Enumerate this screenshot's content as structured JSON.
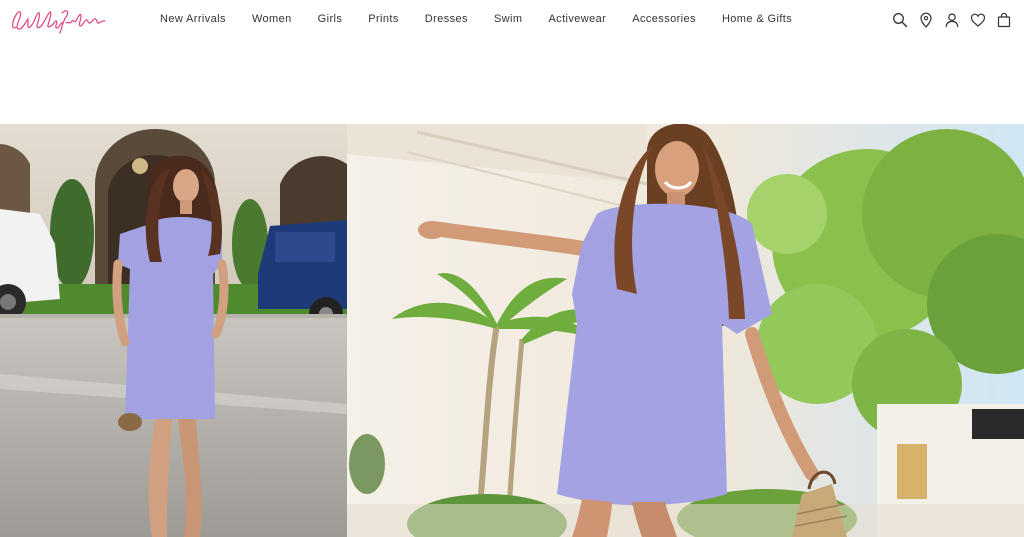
{
  "brand": {
    "name": "Lilly Pulitzer",
    "logo_script": "Lilly Pulitzer",
    "accent": "#e0437f"
  },
  "nav": {
    "items": [
      {
        "label": "New Arrivals"
      },
      {
        "label": "Women"
      },
      {
        "label": "Girls"
      },
      {
        "label": "Prints"
      },
      {
        "label": "Dresses"
      },
      {
        "label": "Swim"
      },
      {
        "label": "Activewear"
      },
      {
        "label": "Accessories"
      },
      {
        "label": "Home & Gifts"
      }
    ]
  },
  "header_icons": [
    "search-icon",
    "location-pin-icon",
    "account-icon",
    "wishlist-heart-icon",
    "shopping-bag-icon"
  ],
  "hero": {
    "images": [
      {
        "subject": "model in lavender tweed shift dress walking on street"
      },
      {
        "subject": "smiling model in lavender tweed shift dress holding woven bag, palms in background"
      }
    ],
    "colors": {
      "dress": "#a9a8e6",
      "foliage": "#7db243",
      "stone": "#e8e1d4",
      "sky": "#cfe6f5"
    }
  }
}
